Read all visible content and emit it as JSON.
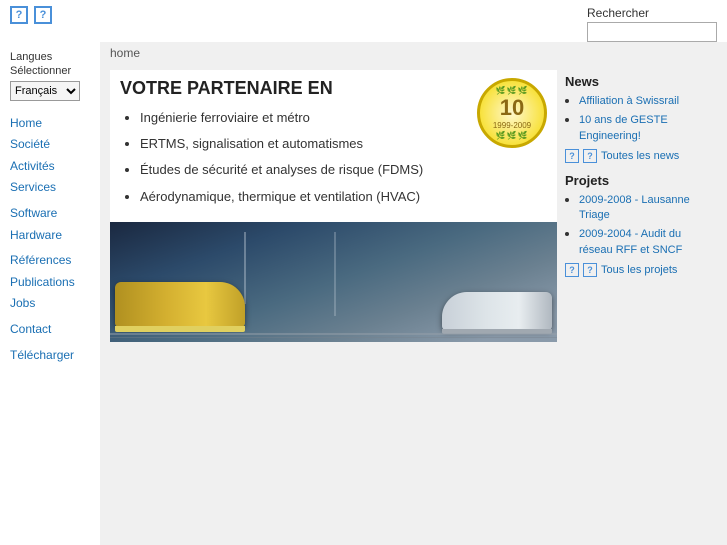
{
  "topIcons": [
    {
      "name": "help-icon-1",
      "symbol": "?"
    },
    {
      "name": "help-icon-2",
      "symbol": "?"
    }
  ],
  "search": {
    "label": "Rechercher",
    "placeholder": ""
  },
  "language": {
    "label_line1": "Langues",
    "label_line2": "Sélectionner",
    "options": [
      "Français"
    ],
    "selected": "Français"
  },
  "nav": {
    "items": [
      {
        "label": "Home",
        "href": "#",
        "group": 1
      },
      {
        "label": "Société",
        "href": "#",
        "group": 1
      },
      {
        "label": "Activités",
        "href": "#",
        "group": 1
      },
      {
        "label": "Services",
        "href": "#",
        "group": 1
      },
      {
        "label": "Software",
        "href": "#",
        "group": 2
      },
      {
        "label": "Hardware",
        "href": "#",
        "group": 2
      },
      {
        "label": "Références",
        "href": "#",
        "group": 3
      },
      {
        "label": "Publications",
        "href": "#",
        "group": 3
      },
      {
        "label": "Jobs",
        "href": "#",
        "group": 3
      },
      {
        "label": "Contact",
        "href": "#",
        "group": 4
      },
      {
        "label": "Télécharger",
        "href": "#",
        "group": 5
      }
    ]
  },
  "breadcrumb": "home",
  "hero": {
    "title": "VOTRE PARTENAIRE EN",
    "items": [
      "Ingénierie ferroviaire et métro",
      "ERTMS, signalisation et automatismes",
      "Études de sécurité et analyses de risque (FDMS)",
      "Aérodynamique, thermique et ventilation (HVAC)"
    ]
  },
  "badge": {
    "number": "10",
    "years": "1999-2009"
  },
  "news": {
    "title": "News",
    "items": [
      {
        "label": "Affiliation à Swissrail",
        "href": "#"
      },
      {
        "label": "10 ans de GESTE Engineering!",
        "href": "#"
      }
    ],
    "all_news_label": "Toutes les news"
  },
  "projects": {
    "title": "Projets",
    "items": [
      {
        "label": "2009-2008 - Lausanne Triage",
        "href": "#"
      },
      {
        "label": "2009-2004 - Audit du réseau RFF et SNCF",
        "href": "#"
      }
    ],
    "all_projects_label": "Tous les projets"
  },
  "smallIcons": [
    {
      "symbol": "?"
    },
    {
      "symbol": "?"
    }
  ]
}
